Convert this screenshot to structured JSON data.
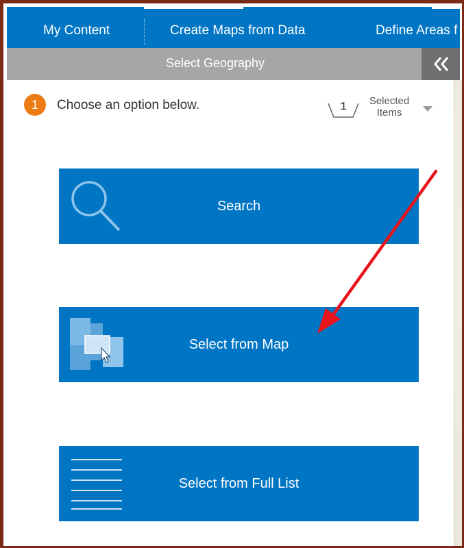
{
  "nav": {
    "tabs": [
      {
        "label": "My Content"
      },
      {
        "label": "Create Maps from Data"
      },
      {
        "label": "Define Areas f"
      }
    ]
  },
  "panel": {
    "title": "Select Geography",
    "collapse_glyph": "«"
  },
  "step": {
    "number": "1",
    "text": "Choose an option below."
  },
  "selected_items": {
    "count": "1",
    "label_line1": "Selected",
    "label_line2": "Items"
  },
  "options": [
    {
      "label": "Search",
      "icon": "magnifier-icon"
    },
    {
      "label": "Select from Map",
      "icon": "map-select-icon"
    },
    {
      "label": "Select from Full List",
      "icon": "list-icon"
    }
  ],
  "colors": {
    "accent": "#0075c4",
    "badge": "#ec7b14",
    "subbar": "#a6a6a6",
    "annotation_arrow": "#e8141b"
  }
}
